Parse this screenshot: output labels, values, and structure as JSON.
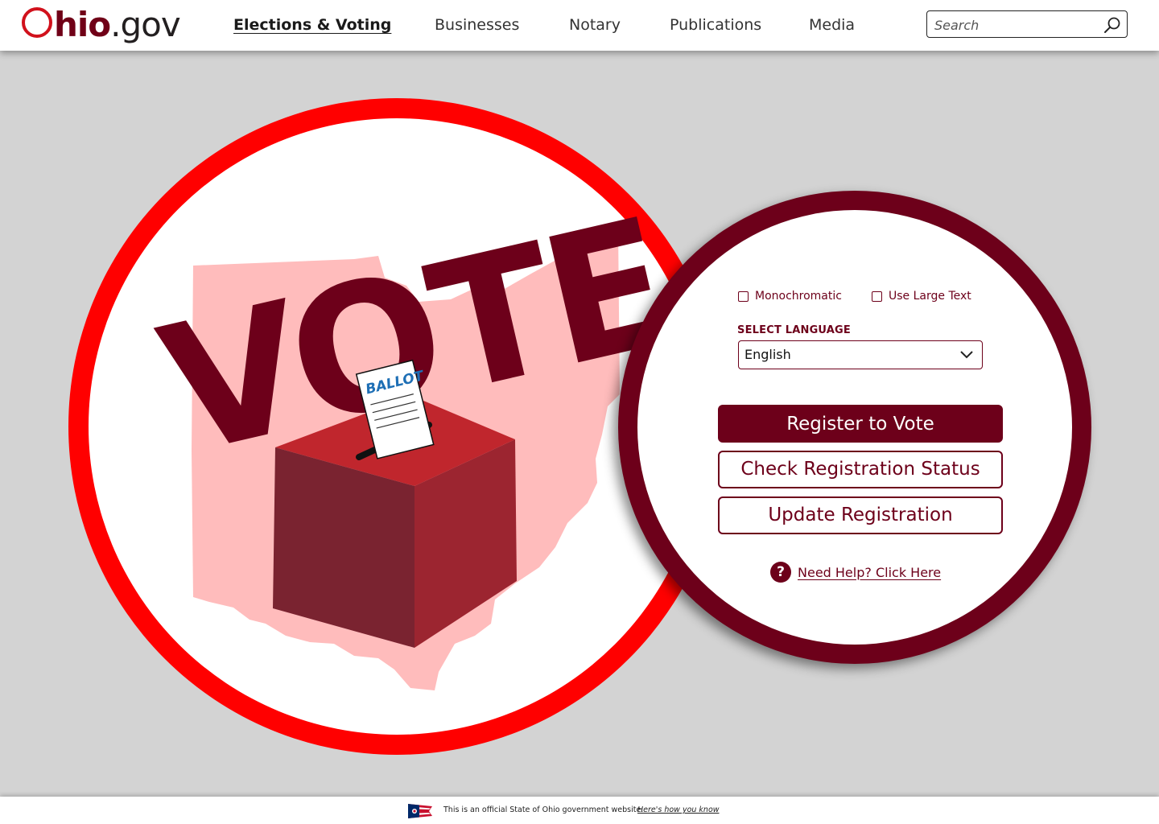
{
  "header": {
    "logo": {
      "o": "O",
      "hio": "hio",
      "gov": ".gov"
    },
    "nav": [
      {
        "label": "Elections & Voting",
        "active": true
      },
      {
        "label": "Businesses",
        "active": false
      },
      {
        "label": "Notary",
        "active": false
      },
      {
        "label": "Publications",
        "active": false
      },
      {
        "label": "Media",
        "active": false
      }
    ],
    "search": {
      "placeholder": "Search",
      "value": "",
      "icon": "search-icon"
    }
  },
  "hero": {
    "headline": "VOTE",
    "ballot_label": "BALLOT",
    "colors": {
      "outer_ring": "#ff0000",
      "state_shape": "#ffbcbc",
      "headline": "#6d001a",
      "box_top": "#c0262d",
      "box_left": "#7a2330",
      "box_right": "#9c2530"
    }
  },
  "panel": {
    "options": {
      "monochromatic": {
        "label": "Monochromatic",
        "checked": false
      },
      "large_text": {
        "label": "Use Large Text",
        "checked": false
      }
    },
    "language": {
      "label": "SELECT LANGUAGE",
      "selected": "English"
    },
    "buttons": {
      "register": "Register to Vote",
      "check_status": "Check Registration Status",
      "update": "Update Registration"
    },
    "help": {
      "icon_glyph": "?",
      "label": "Need Help? Click Here"
    },
    "colors": {
      "primary": "#6d001a"
    }
  },
  "footer": {
    "official_text": "This is an official State of Ohio government website.",
    "link_text": "Here's how you know"
  }
}
